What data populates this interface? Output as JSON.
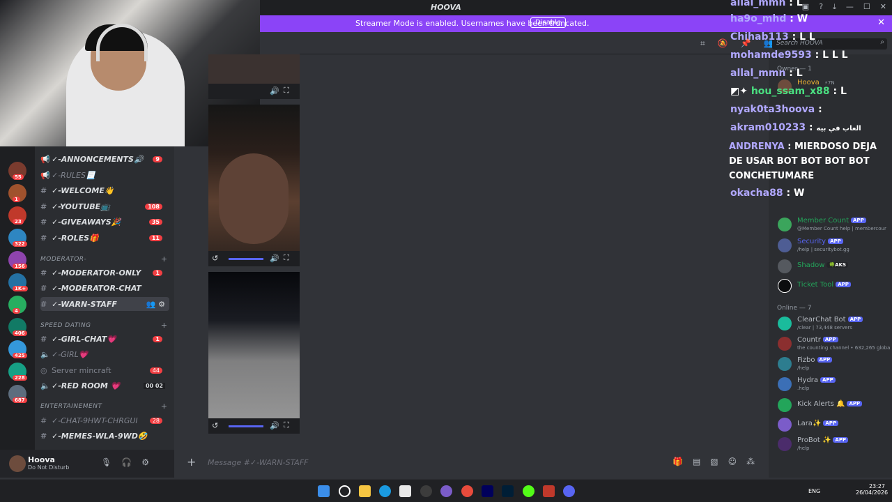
{
  "app": {
    "title": "HOOVA"
  },
  "banner": {
    "text": "Streamer Mode is enabled. Usernames have been truncated.",
    "button": "Disable",
    "close": "✕"
  },
  "channels": [
    {
      "label": "✓-ANNONCEMENTS🔊",
      "badge": "9",
      "icon": "megaphone-icon"
    },
    {
      "label": "✓-RULES📃",
      "badge": "",
      "icon": "megaphone-icon"
    },
    {
      "label": "✓-WELCOME👋",
      "badge": "",
      "icon": "hash-icon"
    },
    {
      "label": "✓-YOUTUBE📺",
      "badge": "108",
      "icon": "hash-icon"
    },
    {
      "label": "✓-GIVEAWAYS🎉",
      "badge": "35",
      "icon": "hash-icon"
    },
    {
      "label": "✓-ROLES🎁",
      "badge": "11",
      "icon": "hash-icon"
    }
  ],
  "categories": {
    "moderator": "MODERATOR-",
    "speed_dating": "SPEED DATING",
    "entertainement": "ENTERTAINEMENT"
  },
  "mod_channels": [
    {
      "label": "✓-MODERATOR-ONLY",
      "badge": "1"
    },
    {
      "label": "✓-MODERATOR-CHAT",
      "badge": ""
    },
    {
      "label": "✓-WARN-STAFF",
      "badge": ""
    }
  ],
  "dating_channels": [
    {
      "label": "✓-GIRL-CHAT💗",
      "badge": "1"
    },
    {
      "label": "✓-GIRL💗",
      "badge": ""
    },
    {
      "label": "Server mincraft",
      "badge": "44"
    },
    {
      "label": "✓-RED ROOM 💗",
      "badge": "",
      "counts": "00  02"
    }
  ],
  "ent_channels": [
    {
      "label": "✓-CHAT-9HWT-CHRGUI",
      "badge": "28"
    },
    {
      "label": "✓-MEMES-WLA-9WD🤣",
      "badge": ""
    }
  ],
  "server_badges": [
    "55",
    "1",
    "23",
    "322",
    "156",
    "1K+",
    "4",
    "406",
    "425",
    "228",
    "687"
  ],
  "user": {
    "name": "Hoova",
    "status": "Do Not Disturb"
  },
  "composer": {
    "placeholder": "Message #✓-WARN-STAFF"
  },
  "search": {
    "placeholder": "Search HOOVA"
  },
  "members": {
    "owner_group": "Owner — 1",
    "owner": {
      "name": "Hoova",
      "badge": "⚡7N"
    },
    "online_group": "Online — 7",
    "apps_top": [
      {
        "name": "Member Count",
        "sub": "@Member Count help | membercour",
        "app": "APP",
        "color": "#23a55a"
      },
      {
        "name": "Security",
        "sub": "/help | securitybot.gg",
        "app": "APP",
        "color": "#5865f2"
      },
      {
        "name": "Shadow",
        "sub": "",
        "app": "🍀AKS",
        "color": "#23a55a"
      },
      {
        "name": "Ticket Tool",
        "sub": "",
        "app": "APP",
        "color": "#23a55a"
      }
    ],
    "online": [
      {
        "name": "ClearChat Bot",
        "sub": "/clear | 73,448 servers",
        "app": "APP"
      },
      {
        "name": "Countr",
        "sub": "the counting channel • 632,265 globa",
        "app": "APP"
      },
      {
        "name": "Fizbo",
        "sub": "/help",
        "app": "APP"
      },
      {
        "name": "Hydra",
        "sub": ".help",
        "app": "APP"
      },
      {
        "name": "Kick Alerts 🔔",
        "sub": "",
        "app": "APP"
      },
      {
        "name": "Lara✨",
        "sub": "",
        "app": "APP"
      },
      {
        "name": "ProBot ✨",
        "sub": "/help",
        "app": "APP"
      }
    ]
  },
  "overlay": [
    {
      "user": "allal_mmn",
      "msg": "L"
    },
    {
      "user": "ha9o_mhd",
      "msg": "W"
    },
    {
      "user": "Chihab113",
      "msg": "L L"
    },
    {
      "user": "mohamde9593",
      "msg": "L L L"
    },
    {
      "user": "allal_mmn",
      "msg": "L"
    },
    {
      "user": "hou_ssam_x88",
      "msg": "L"
    },
    {
      "user": "nyak0ta3hoova",
      "msg": ""
    },
    {
      "user": "akram010233",
      "msg": "العاب في بيه"
    },
    {
      "user": "okacha88",
      "msg": "W"
    }
  ],
  "overlay_long": {
    "user": "ANDRENYA",
    "msg": "MIERDOSO DEJA DE USAR BOT BOT BOT BOT CONCHETUMARE"
  },
  "taskbar": {
    "lang": "ENG",
    "time": "23:27",
    "date": "26/04/2026"
  },
  "colors": {
    "accent": "#5865f2",
    "banner": "#8b44f7",
    "mention": "#f23f43"
  }
}
